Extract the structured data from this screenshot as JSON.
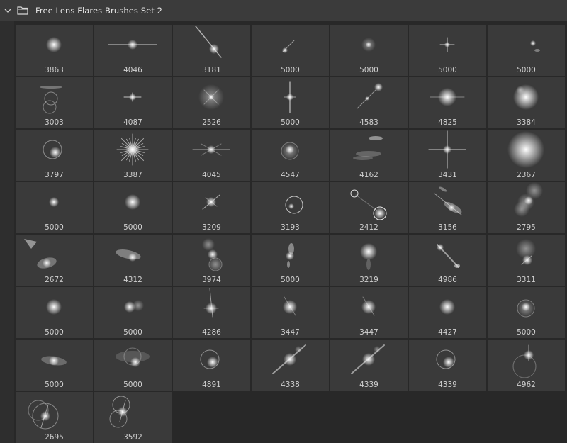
{
  "panel": {
    "title": "Free Lens Flares Brushes Set 2",
    "chevron_icon": "chevron-down-icon",
    "folder_icon": "folder-icon"
  },
  "brushes": [
    {
      "size": "3863",
      "style": "glow"
    },
    {
      "size": "4046",
      "style": "hline"
    },
    {
      "size": "3181",
      "style": "diag-streak"
    },
    {
      "size": "5000",
      "style": "small-diag"
    },
    {
      "size": "5000",
      "style": "dim-glow"
    },
    {
      "size": "5000",
      "style": "star-small"
    },
    {
      "size": "5000",
      "style": "tiny-pair"
    },
    {
      "size": "3003",
      "style": "rings-stack"
    },
    {
      "size": "4087",
      "style": "cross-small"
    },
    {
      "size": "2526",
      "style": "soft-x"
    },
    {
      "size": "5000",
      "style": "vline"
    },
    {
      "size": "4583",
      "style": "diag-dots"
    },
    {
      "size": "4825",
      "style": "hglow"
    },
    {
      "size": "3384",
      "style": "big-glow"
    },
    {
      "size": "3797",
      "style": "ring-flare"
    },
    {
      "size": "3387",
      "style": "burst"
    },
    {
      "size": "4045",
      "style": "star-wide"
    },
    {
      "size": "4547",
      "style": "ring-glow"
    },
    {
      "size": "4162",
      "style": "smear"
    },
    {
      "size": "3431",
      "style": "cross-big"
    },
    {
      "size": "2367",
      "style": "huge-glow"
    },
    {
      "size": "5000",
      "style": "dot"
    },
    {
      "size": "5000",
      "style": "glow"
    },
    {
      "size": "3209",
      "style": "diag-star"
    },
    {
      "size": "3193",
      "style": "circle-outline"
    },
    {
      "size": "2412",
      "style": "orbs"
    },
    {
      "size": "3156",
      "style": "diag-chain"
    },
    {
      "size": "2795",
      "style": "blob-chain"
    },
    {
      "size": "2672",
      "style": "triangle-smear"
    },
    {
      "size": "4312",
      "style": "hsmear"
    },
    {
      "size": "3974",
      "style": "bubble-stack"
    },
    {
      "size": "5000",
      "style": "vchain"
    },
    {
      "size": "3219",
      "style": "vglow"
    },
    {
      "size": "4986",
      "style": "diag-chain2"
    },
    {
      "size": "3311",
      "style": "faint-ring"
    },
    {
      "size": "5000",
      "style": "glow"
    },
    {
      "size": "5000",
      "style": "double"
    },
    {
      "size": "4286",
      "style": "vstreak"
    },
    {
      "size": "3447",
      "style": "glow-streak"
    },
    {
      "size": "3447",
      "style": "glow-streak"
    },
    {
      "size": "4427",
      "style": "glow"
    },
    {
      "size": "5000",
      "style": "ring-glow"
    },
    {
      "size": "5000",
      "style": "oval"
    },
    {
      "size": "5000",
      "style": "oval-ring"
    },
    {
      "size": "4891",
      "style": "ring-flare"
    },
    {
      "size": "4338",
      "style": "diag-glow"
    },
    {
      "size": "4339",
      "style": "diag-glow"
    },
    {
      "size": "4339",
      "style": "ring-flare"
    },
    {
      "size": "4962",
      "style": "arc-flare"
    },
    {
      "size": "2695",
      "style": "double-ring"
    },
    {
      "size": "3592",
      "style": "ring-stack"
    }
  ]
}
